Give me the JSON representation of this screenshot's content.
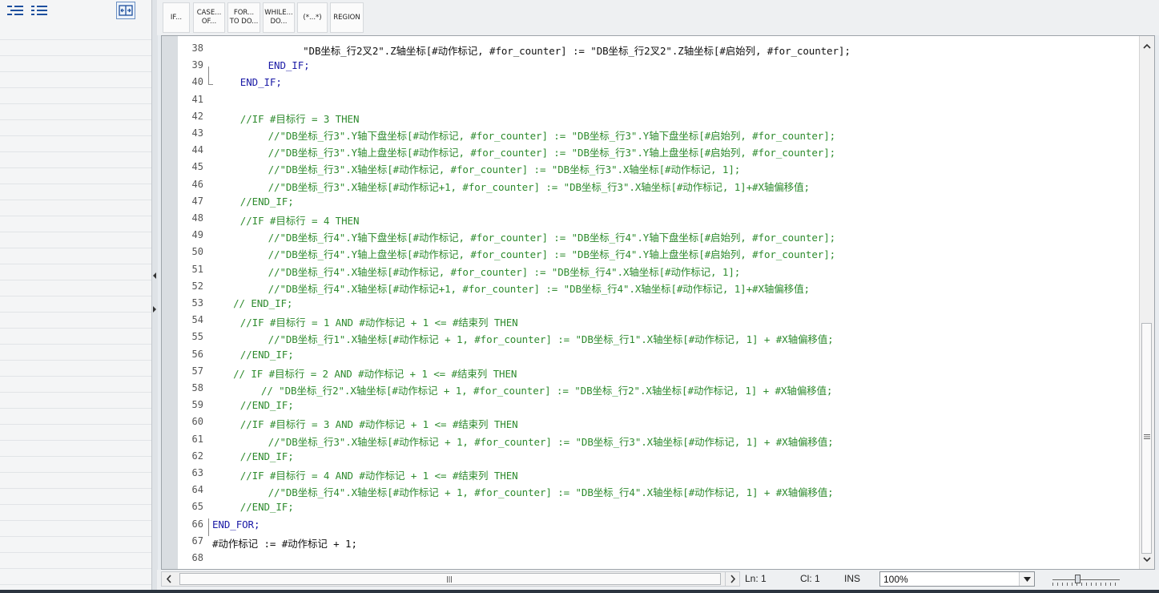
{
  "toolbar": {
    "buttons": [
      {
        "line1": "IF...",
        "line2": ""
      },
      {
        "line1": "CASE...",
        "line2": "OF..."
      },
      {
        "line1": "FOR...",
        "line2": "TO DO..."
      },
      {
        "line1": "WHILE...",
        "line2": "DO..."
      },
      {
        "line1": "(*...*)",
        "line2": ""
      },
      {
        "line1": "REGION",
        "line2": ""
      }
    ]
  },
  "left_panel": {
    "icons": [
      "indent-list-icon",
      "outdent-list-icon",
      "expand-pane-icon"
    ]
  },
  "editor": {
    "lines": [
      {
        "n": "38",
        "indent": 13,
        "kind": "tx",
        "text": "\"DB坐标_行2叉2\".Z轴坐标[#动作标记, #for_counter] := \"DB坐标_行2叉2\".Z轴坐标[#启始列, #for_counter];"
      },
      {
        "n": "39",
        "indent": 8,
        "kind": "kw",
        "text": "END_IF;"
      },
      {
        "n": "40",
        "indent": 4,
        "kind": "kw",
        "text": "END_IF;"
      },
      {
        "n": "41",
        "indent": 0,
        "kind": "tx",
        "text": ""
      },
      {
        "n": "42",
        "indent": 4,
        "kind": "cm",
        "text": "//IF #目标行 = 3 THEN"
      },
      {
        "n": "43",
        "indent": 8,
        "kind": "cm",
        "text": "//\"DB坐标_行3\".Y轴下盘坐标[#动作标记, #for_counter] := \"DB坐标_行3\".Y轴下盘坐标[#启始列, #for_counter];"
      },
      {
        "n": "44",
        "indent": 8,
        "kind": "cm",
        "text": "//\"DB坐标_行3\".Y轴上盘坐标[#动作标记, #for_counter] := \"DB坐标_行3\".Y轴上盘坐标[#启始列, #for_counter];"
      },
      {
        "n": "45",
        "indent": 8,
        "kind": "cm",
        "text": "//\"DB坐标_行3\".X轴坐标[#动作标记, #for_counter] := \"DB坐标_行3\".X轴坐标[#动作标记, 1];"
      },
      {
        "n": "46",
        "indent": 8,
        "kind": "cm",
        "text": "//\"DB坐标_行3\".X轴坐标[#动作标记+1, #for_counter] := \"DB坐标_行3\".X轴坐标[#动作标记, 1]+#X轴偏移值;"
      },
      {
        "n": "47",
        "indent": 4,
        "kind": "cm",
        "text": "//END_IF;"
      },
      {
        "n": "48",
        "indent": 4,
        "kind": "cm",
        "text": "//IF #目标行 = 4 THEN"
      },
      {
        "n": "49",
        "indent": 8,
        "kind": "cm",
        "text": "//\"DB坐标_行4\".Y轴下盘坐标[#动作标记, #for_counter] := \"DB坐标_行4\".Y轴下盘坐标[#启始列, #for_counter];"
      },
      {
        "n": "50",
        "indent": 8,
        "kind": "cm",
        "text": "//\"DB坐标_行4\".Y轴上盘坐标[#动作标记, #for_counter] := \"DB坐标_行4\".Y轴上盘坐标[#启始列, #for_counter];"
      },
      {
        "n": "51",
        "indent": 8,
        "kind": "cm",
        "text": "//\"DB坐标_行4\".X轴坐标[#动作标记, #for_counter] := \"DB坐标_行4\".X轴坐标[#动作标记, 1];"
      },
      {
        "n": "52",
        "indent": 8,
        "kind": "cm",
        "text": "//\"DB坐标_行4\".X轴坐标[#动作标记+1, #for_counter] := \"DB坐标_行4\".X轴坐标[#动作标记, 1]+#X轴偏移值;"
      },
      {
        "n": "53",
        "indent": 3,
        "kind": "cm",
        "text": "// END_IF;"
      },
      {
        "n": "54",
        "indent": 4,
        "kind": "cm",
        "text": "//IF #目标行 = 1 AND #动作标记 + 1 <= #结束列 THEN"
      },
      {
        "n": "55",
        "indent": 8,
        "kind": "cm",
        "text": "//\"DB坐标_行1\".X轴坐标[#动作标记 + 1, #for_counter] := \"DB坐标_行1\".X轴坐标[#动作标记, 1] + #X轴偏移值;"
      },
      {
        "n": "56",
        "indent": 4,
        "kind": "cm",
        "text": "//END_IF;"
      },
      {
        "n": "57",
        "indent": 3,
        "kind": "cm",
        "text": "// IF #目标行 = 2 AND #动作标记 + 1 <= #结束列 THEN"
      },
      {
        "n": "58",
        "indent": 7,
        "kind": "cm",
        "text": "// \"DB坐标_行2\".X轴坐标[#动作标记 + 1, #for_counter] := \"DB坐标_行2\".X轴坐标[#动作标记, 1] + #X轴偏移值;"
      },
      {
        "n": "59",
        "indent": 4,
        "kind": "cm",
        "text": "//END_IF;"
      },
      {
        "n": "60",
        "indent": 4,
        "kind": "cm",
        "text": "//IF #目标行 = 3 AND #动作标记 + 1 <= #结束列 THEN"
      },
      {
        "n": "61",
        "indent": 8,
        "kind": "cm",
        "text": "//\"DB坐标_行3\".X轴坐标[#动作标记 + 1, #for_counter] := \"DB坐标_行3\".X轴坐标[#动作标记, 1] + #X轴偏移值;"
      },
      {
        "n": "62",
        "indent": 4,
        "kind": "cm",
        "text": "//END_IF;"
      },
      {
        "n": "63",
        "indent": 4,
        "kind": "cm",
        "text": "//IF #目标行 = 4 AND #动作标记 + 1 <= #结束列 THEN"
      },
      {
        "n": "64",
        "indent": 8,
        "kind": "cm",
        "text": "//\"DB坐标_行4\".X轴坐标[#动作标记 + 1, #for_counter] := \"DB坐标_行4\".X轴坐标[#动作标记, 1] + #X轴偏移值;"
      },
      {
        "n": "65",
        "indent": 4,
        "kind": "cm",
        "text": "//END_IF;"
      },
      {
        "n": "66",
        "indent": 0,
        "kind": "kw",
        "text": "END_FOR;"
      },
      {
        "n": "67",
        "indent": 0,
        "kind": "tx",
        "text": "#动作标记 := #动作标记 + 1;"
      },
      {
        "n": "68",
        "indent": 0,
        "kind": "tx",
        "text": ""
      }
    ]
  },
  "statusbar": {
    "ln_label": "Ln: 1",
    "col_label": "Cl: 1",
    "mode": "INS",
    "zoom": "100%"
  },
  "colors": {
    "keyword": "#1a1aa6",
    "comment": "#2e8b2e",
    "text": "#111111"
  }
}
